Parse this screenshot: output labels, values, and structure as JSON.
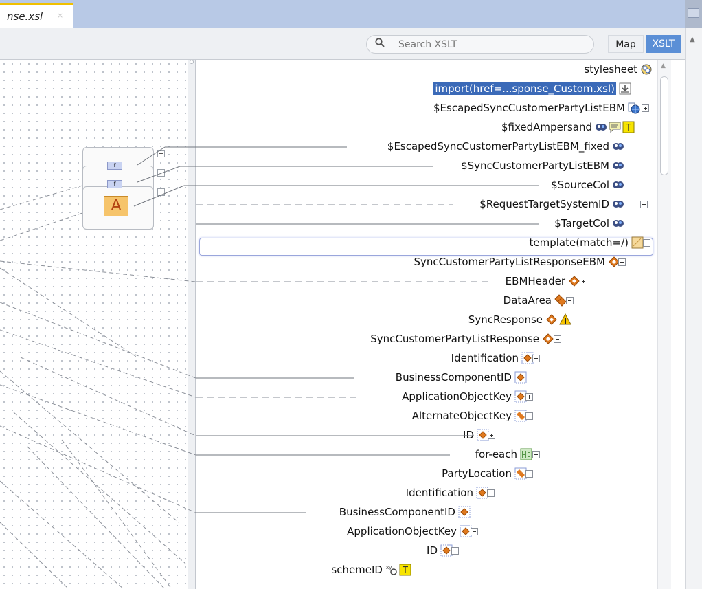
{
  "tab": {
    "label": "nse.xsl",
    "close": "×"
  },
  "search": {
    "placeholder": "Search XSLT"
  },
  "view_toggle": {
    "map_label": "Map",
    "xslt_label": "XSLT"
  },
  "function_block": {
    "fn1": "f",
    "fn2": "f",
    "constant": "A"
  },
  "tree": {
    "nodes": [
      {
        "label": "stylesheet",
        "icon": "stylesheet-icon"
      },
      {
        "label": "import(href=...sponse_Custom.xsl)",
        "icon": "import-icon",
        "selected": true
      },
      {
        "label": "$EscapedSyncCustomerPartyListEBM",
        "icon": "global-variable-icon",
        "toggle": "plus"
      },
      {
        "label": "$fixedAmpersand",
        "icon": "variable-icon",
        "extra_icons": [
          "comment-icon",
          "text-icon"
        ]
      },
      {
        "label": "$EscapedSyncCustomerPartyListEBM_fixed",
        "icon": "variable-icon"
      },
      {
        "label": "$SyncCustomerPartyListEBM",
        "icon": "variable-icon"
      },
      {
        "label": "$SourceCol",
        "icon": "variable-icon"
      },
      {
        "label": "$RequestTargetSystemID",
        "icon": "variable-icon",
        "toggle": "plus"
      },
      {
        "label": "$TargetCol",
        "icon": "variable-icon"
      },
      {
        "label": "template(match=/)",
        "icon": "template-icon",
        "toggle": "minus"
      },
      {
        "label": "SyncCustomerPartyListResponseEBM",
        "icon": "element-icon",
        "toggle": "minus"
      },
      {
        "label": "EBMHeader",
        "icon": "element-icon",
        "toggle": "plus"
      },
      {
        "label": "DataArea",
        "icon": "element-repeat-icon",
        "toggle": "minus"
      },
      {
        "label": "SyncResponse",
        "icon": "element-icon",
        "extra_icons": [
          "warning-icon"
        ]
      },
      {
        "label": "SyncCustomerPartyListResponse",
        "icon": "element-icon",
        "toggle": "minus"
      },
      {
        "label": "Identification",
        "icon": "element-optional-icon",
        "toggle": "minus"
      },
      {
        "label": "BusinessComponentID",
        "icon": "element-optional-icon"
      },
      {
        "label": "ApplicationObjectKey",
        "icon": "element-optional-icon",
        "toggle": "plus"
      },
      {
        "label": "AlternateObjectKey",
        "icon": "element-optional-repeat-icon",
        "toggle": "minus"
      },
      {
        "label": "ID",
        "icon": "element-optional-icon",
        "toggle": "plus"
      },
      {
        "label": "for-each",
        "icon": "for-each-icon",
        "toggle": "minus"
      },
      {
        "label": "PartyLocation",
        "icon": "element-optional-repeat-icon",
        "toggle": "minus"
      },
      {
        "label": "Identification",
        "icon": "element-optional-icon",
        "toggle": "minus"
      },
      {
        "label": "BusinessComponentID",
        "icon": "element-optional-icon"
      },
      {
        "label": "ApplicationObjectKey",
        "icon": "element-optional-icon",
        "toggle": "minus"
      },
      {
        "label": "ID",
        "icon": "element-optional-icon",
        "toggle": "minus"
      },
      {
        "label": "schemeID",
        "icon": "attribute-icon",
        "extra_icons": [
          "text-icon"
        ]
      }
    ]
  },
  "colors": {
    "selection": "#3b6ab8",
    "toolbar_active": "#5b8fd6",
    "tab_accent": "#f0c000",
    "element_icon": "#e07a1f",
    "variable_icon": "#3c4f84"
  }
}
